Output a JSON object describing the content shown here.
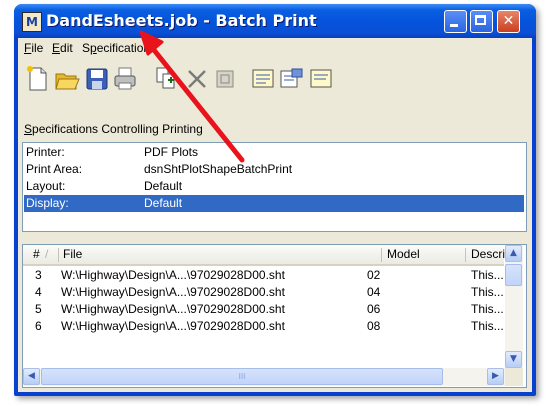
{
  "window": {
    "title": "DandEsheets.job - Batch Print",
    "app_icon_glyph": "M",
    "minimize_icon": "minimize-icon",
    "maximize_icon": "maximize-icon",
    "close_glyph": "✕"
  },
  "menu": {
    "file": {
      "u": "F",
      "rest": "ile"
    },
    "edit": {
      "u": "E",
      "rest": "dit"
    },
    "specifications": {
      "pre": "S",
      "u": "p",
      "rest": "ecifications"
    }
  },
  "toolbar": {
    "icons": [
      "new-icon",
      "open-folder-icon",
      "save-disk-icon",
      "print-icon",
      "add-files-icon",
      "delete-x-icon",
      "disabled-icon",
      "specifications-icon",
      "edit-spec-icon",
      "preview-icon"
    ]
  },
  "specifications": {
    "section_label": {
      "u": "S",
      "rest": "pecifications Controlling Printing"
    },
    "rows": [
      {
        "key": "Printer:",
        "value": "PDF Plots"
      },
      {
        "key": "Print Area:",
        "value": "dsnShtPlotShapeBatchPrint"
      },
      {
        "key": "Layout:",
        "value": "Default"
      },
      {
        "key": "Display:",
        "value": "Default",
        "selected": true
      }
    ]
  },
  "file_list": {
    "columns": {
      "num": "#",
      "sort_glyph": "/",
      "file": "File",
      "model": "Model",
      "description": "Descript"
    },
    "rows": [
      {
        "num": "3",
        "file": "W:\\Highway\\Design\\A...\\97029028D00.sht",
        "model": "02",
        "description": "This..."
      },
      {
        "num": "4",
        "file": "W:\\Highway\\Design\\A...\\97029028D00.sht",
        "model": "04",
        "description": "This..."
      },
      {
        "num": "5",
        "file": "W:\\Highway\\Design\\A...\\97029028D00.sht",
        "model": "06",
        "description": "This..."
      },
      {
        "num": "6",
        "file": "W:\\Highway\\Design\\A...\\97029028D00.sht",
        "model": "08",
        "description": "This..."
      }
    ],
    "scroll_up": "▲",
    "scroll_down": "▼",
    "scroll_left": "◀",
    "scroll_right": "▶",
    "thumb_grip": "III"
  },
  "annotation": {
    "arrow_color": "#e8131b"
  },
  "colors": {
    "selection": "#316ac5",
    "titlebar": "#0553dc",
    "dialog_face": "#ece9d8"
  }
}
